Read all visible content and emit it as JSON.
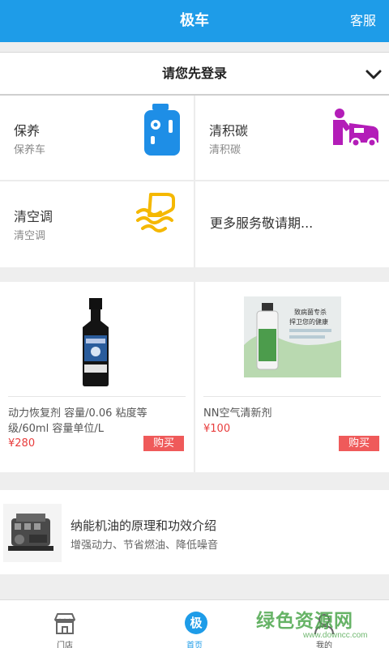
{
  "header": {
    "title": "极车",
    "service_label": "客服"
  },
  "login": {
    "text": "请您先登录"
  },
  "services": [
    {
      "name": "保养",
      "sub": "保养车",
      "icon": "oil-canister-icon",
      "color": "#1e8ee6"
    },
    {
      "name": "清积碳",
      "sub": "清积碳",
      "icon": "car-mechanic-icon",
      "color": "#b31db8"
    },
    {
      "name": "清空调",
      "sub": "清空调",
      "icon": "air-conditioner-icon",
      "color": "#f5b800"
    },
    {
      "more_text": "更多服务敬请期..."
    }
  ],
  "products": [
    {
      "name": "动力恢复剂 容量/0.06 粘度等级/60ml 容量单位/L",
      "price": "¥280",
      "buy_label": "购买"
    },
    {
      "name": "NN空气清新剂",
      "price": "¥100",
      "buy_label": "购买",
      "image_text": [
        "致病菌专杀",
        "捍卫您的健康"
      ]
    }
  ],
  "article": {
    "title": "纳能机油的原理和功效介绍",
    "subtitle": "增强动力、节省燃油、降低噪音"
  },
  "tabs": [
    {
      "label": "门店",
      "icon": "store-icon"
    },
    {
      "label": "首页",
      "icon_text": "极"
    },
    {
      "label": "我的",
      "icon": "user-icon"
    }
  ],
  "watermark": {
    "text": "绿色资源网",
    "url": "www.downcc.com"
  },
  "colors": {
    "brand": "#1e9ce8",
    "price": "#e83d3d",
    "buy": "#ef5a5a"
  }
}
